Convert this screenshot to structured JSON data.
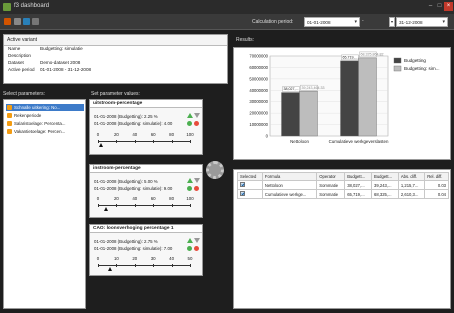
{
  "window": {
    "title": "f3 dashboard"
  },
  "toolbar": {
    "period_label": "Calculation period:",
    "from_date": "01-01-2008",
    "to_date": "31-12-2008"
  },
  "active_variant": {
    "title": "Active variant",
    "rows": [
      {
        "key": "Name",
        "value": "Budgetting: simulatie"
      },
      {
        "key": "Description",
        "value": ""
      },
      {
        "key": "Dataset",
        "value": "Demo-dataset 2008"
      },
      {
        "key": "Active period",
        "value": "01-01-2008 - 31-12-2008"
      }
    ]
  },
  "select_parameters": {
    "title": "Select parameters:",
    "items": [
      {
        "label": "Schnalle uitkering: No...",
        "selected": true
      },
      {
        "label": "Rekenperiode",
        "selected": false
      },
      {
        "label": "Salaristoelage: Percenta...",
        "selected": false
      },
      {
        "label": "Vakantietoelage: Percen...",
        "selected": false
      }
    ]
  },
  "parameter_values": {
    "title": "Set parameter values:",
    "blocks": [
      {
        "header": "uitstroom-percentage",
        "line1": "01-01-2008 (Budgetting): 2.25 %",
        "line2": "01-01-2008 (Budgetting: simulatie): 4.00",
        "ticks": [
          "0",
          "20",
          "40",
          "60",
          "80",
          "100"
        ],
        "value": 4
      },
      {
        "header": "instroom-percentage",
        "line1": "01-01-2008 (Budgetting): 5.00 %",
        "line2": "01-01-2008 (Budgetting: simulatie): 9.00",
        "ticks": [
          "0",
          "20",
          "40",
          "60",
          "80",
          "100"
        ],
        "value": 9
      },
      {
        "header": "CAO: loonsverhoging percentage 1",
        "line1": "01-01-2008 (Budgetting): 2.75 %",
        "line2": "01-01-2008 (Budgetting: simulatie): 7.00",
        "ticks": [
          "0",
          "10",
          "20",
          "30",
          "40",
          "50"
        ],
        "value": 7
      }
    ]
  },
  "results": {
    "title": "Results:"
  },
  "chart_data": {
    "type": "bar",
    "categories": [
      "Nettoloon",
      "Cumulatieve werkgeverslasten"
    ],
    "series": [
      {
        "name": "Budgetting",
        "values": [
          38027000,
          65719000
        ],
        "labels": [
          "38,027,...",
          "65,719,..."
        ],
        "color": "#444444"
      },
      {
        "name": "Budgetting: sim...",
        "values": [
          39243000,
          68325000
        ],
        "labels": [
          "39,243,464.33",
          "68,325,864.82"
        ],
        "color": "#bdbdbd"
      }
    ],
    "yticks": [
      "0",
      "10000000",
      "20000000",
      "30000000",
      "40000000",
      "50000000",
      "60000000",
      "70000000"
    ],
    "ylim": [
      0,
      70000000
    ],
    "legend": "right"
  },
  "table": {
    "headers": [
      "Selected",
      "Formula",
      "Operator",
      "Budgett...",
      "Budgett...",
      "Abs. diff.",
      "Rel. diff."
    ],
    "rows": [
      [
        "",
        "Nettoloon",
        "Sommatie",
        "38,027,...",
        "39,243,...",
        "1,215,7...",
        "0.03"
      ],
      [
        "",
        "Cumulatieve werkge...",
        "Sommatie",
        "65,719,...",
        "68,325,...",
        "2,610,3...",
        "0.04"
      ]
    ]
  },
  "colors": {
    "accent": "#3d7bc9",
    "dark_bg": "#1e1e1e",
    "up": "#4caf50",
    "reset": "#e74c3c"
  }
}
